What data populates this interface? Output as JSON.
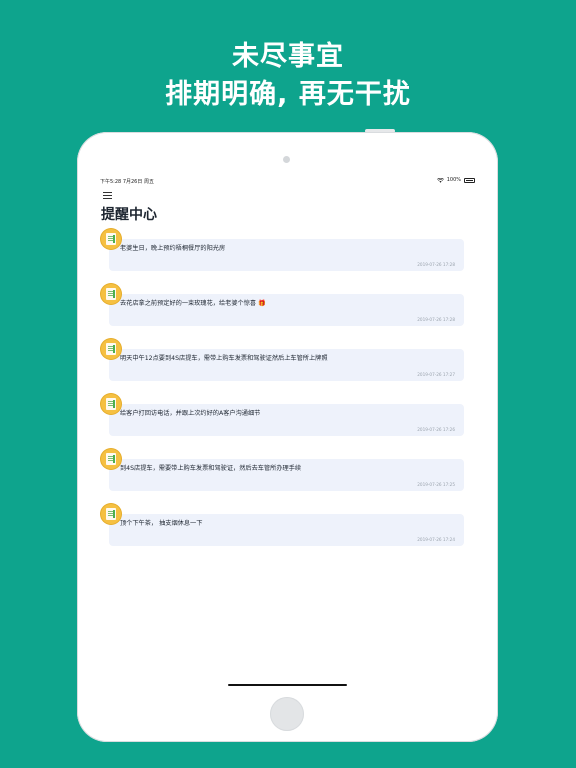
{
  "promo": {
    "line1": "未尽事宜",
    "line2": "排期明确, 再无干扰"
  },
  "status_bar": {
    "time_date": "下午5:28   7月26日 周五",
    "battery": "100%"
  },
  "icons": {
    "menu": "hamburger-menu-icon",
    "wifi": "wifi-icon",
    "battery": "battery-icon",
    "reminder": "notepad-icon"
  },
  "page": {
    "title": "提醒中心"
  },
  "reminders": [
    {
      "text": "老婆生日，晚上预约梧桐餐厅的阳光房",
      "date": "2019-07-26 17:28"
    },
    {
      "text": "去花店拿之前预定好的一束玫瑰花，给老婆个惊喜 🎁",
      "date": "2019-07-26 17:28"
    },
    {
      "text": "明天中午12点要到4S店提车，需带上购车发票和驾驶证然后上车管所上牌照",
      "date": "2019-07-26 17:27"
    },
    {
      "text": "给客户打回访电话，并跟上次约好的A客户沟通细节",
      "date": "2019-07-26 17:26"
    },
    {
      "text": "到4S店提车，需要带上购车发票和驾驶证，然后去车管所办理手续",
      "date": "2019-07-26 17:25"
    },
    {
      "text": "顶个下午茶， 抽支烟休息一下",
      "date": "2019-07-26 17:24"
    }
  ],
  "colors": {
    "background": "#0ea48d",
    "card": "#eef2fb",
    "badge": "#f5c042"
  }
}
